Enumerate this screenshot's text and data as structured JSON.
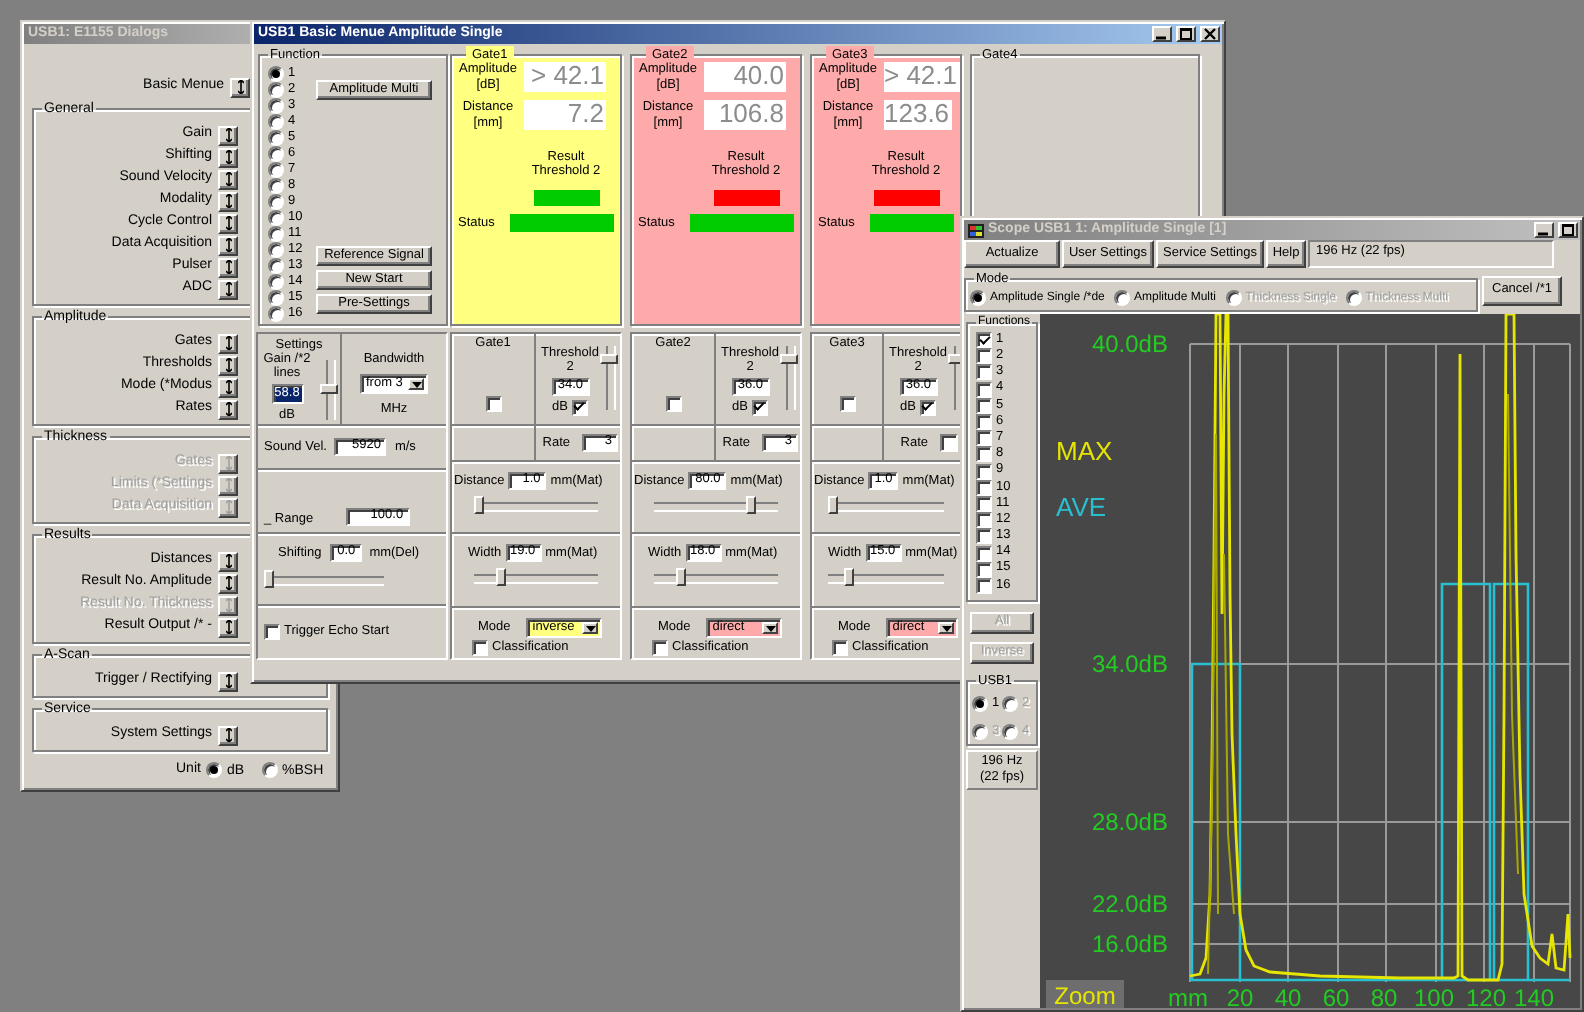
{
  "dialogs_window": {
    "title": "USB1: E1155 Dialogs",
    "active": false,
    "basic_menu": {
      "label": "Basic Menue",
      "disabled": false
    },
    "groups": [
      {
        "title": "General",
        "items": [
          {
            "label": "Gain",
            "disabled": false
          },
          {
            "label": "Shifting",
            "disabled": false
          },
          {
            "label": "Sound Velocity",
            "disabled": false
          },
          {
            "label": "Modality",
            "disabled": false
          },
          {
            "label": "Cycle Control",
            "disabled": false
          },
          {
            "label": "Data Acquisition",
            "disabled": false
          },
          {
            "label": "Pulser",
            "disabled": false
          },
          {
            "label": "ADC",
            "disabled": false
          }
        ]
      },
      {
        "title": "Amplitude",
        "items": [
          {
            "label": "Gates",
            "disabled": false
          },
          {
            "label": "Thresholds",
            "disabled": false
          },
          {
            "label": "Mode (*Modus",
            "disabled": false
          },
          {
            "label": "Rates",
            "disabled": false
          }
        ]
      },
      {
        "title": "Thickness",
        "items": [
          {
            "label": "Gates",
            "disabled": true
          },
          {
            "label": "Limits (*Settings",
            "disabled": true
          },
          {
            "label": "Data Acquisition",
            "disabled": true
          }
        ]
      },
      {
        "title": "Results",
        "items": [
          {
            "label": "Distances",
            "disabled": false
          },
          {
            "label": "Result No. Amplitude",
            "disabled": false
          },
          {
            "label": "Result No. Thickness",
            "disabled": true
          },
          {
            "label": "Result Output /* -",
            "disabled": false
          }
        ]
      },
      {
        "title": "A-Scan",
        "items": [
          {
            "label": "Trigger / Rectifying",
            "disabled": false
          }
        ]
      },
      {
        "title": "Service",
        "items": [
          {
            "label": "System Settings",
            "disabled": false
          }
        ]
      }
    ],
    "unit": {
      "label": "Unit",
      "options": [
        {
          "label": "dB",
          "selected": true
        },
        {
          "label": "%BSH",
          "selected": false
        }
      ]
    }
  },
  "basic_window": {
    "title": "USB1 Basic Menue Amplitude Single",
    "active": true,
    "function": {
      "title": "Function",
      "options": [
        {
          "label": "1",
          "selected": true
        },
        {
          "label": "2",
          "selected": false
        },
        {
          "label": "3",
          "selected": false
        },
        {
          "label": "4",
          "selected": false
        },
        {
          "label": "5",
          "selected": false
        },
        {
          "label": "6",
          "selected": false
        },
        {
          "label": "7",
          "selected": false
        },
        {
          "label": "8",
          "selected": false
        },
        {
          "label": "9",
          "selected": false
        },
        {
          "label": "10",
          "selected": false
        },
        {
          "label": "11",
          "selected": false
        },
        {
          "label": "12",
          "selected": false
        },
        {
          "label": "13",
          "selected": false
        },
        {
          "label": "14",
          "selected": false
        },
        {
          "label": "15",
          "selected": false
        },
        {
          "label": "16",
          "selected": false
        }
      ],
      "buttons": [
        "Amplitude Multi",
        "Reference Signal",
        "New Start",
        "Pre-Settings"
      ]
    },
    "settings": {
      "title": "Settings",
      "gain_label": "Gain /*2 lines",
      "gain_value": "58.8",
      "gain_unit": "dB",
      "gain_slider": {
        "level": 0.5
      },
      "bandwidth_label": "Bandwidth",
      "bandwidth_value": "from 3",
      "bandwidth_unit": "MHz"
    },
    "sound_velocity": {
      "label": "Sound Vel.",
      "value": "5920",
      "unit": "m/s"
    },
    "range": {
      "label": "_ Range",
      "value": "100.0"
    },
    "shifting": {
      "label": "Shifting",
      "value": "0.0",
      "unit": "mm(Del)",
      "level": 0
    },
    "trigger_echo_start": {
      "label": "Trigger Echo Start",
      "checked": false
    },
    "gates": [
      {
        "title": "Gate1",
        "color": "#ffff80",
        "amplitude_label": "Amplitude",
        "amplitude_unit": "[dB]",
        "amplitude": "> 42.1",
        "distance_label": "Distance",
        "distance_unit": "[mm]",
        "distance": "7.2",
        "result": {
          "label": "Result Threshold 2",
          "color": "#00cc00"
        },
        "status": {
          "label": "Status",
          "color": "#00cc00"
        },
        "settings_title": "Gate1",
        "enabled": false,
        "threshold": {
          "label": "Threshold 2",
          "value": "34.0",
          "unit": "dB",
          "checked": true,
          "level": 0.85
        },
        "rate": {
          "label": "Rate",
          "value": "3"
        },
        "distance_slider": {
          "label": "Distance",
          "value": "1.0",
          "unit": "mm(Mat)",
          "level": 0
        },
        "width_slider": {
          "label": "Width",
          "value": "19.0",
          "unit": "mm(Mat)",
          "level": 0.2
        },
        "mode": {
          "label": "Mode",
          "value": "inverse"
        },
        "classification": {
          "label": "Classification",
          "checked": false
        }
      },
      {
        "title": "Gate2",
        "color": "#ffaaaa",
        "amplitude_label": "Amplitude",
        "amplitude_unit": "[dB]",
        "amplitude": "40.0",
        "distance_label": "Distance",
        "distance_unit": "[mm]",
        "distance": "106.8",
        "result": {
          "label": "Result Threshold 2",
          "color": "#ff0000"
        },
        "status": {
          "label": "Status",
          "color": "#00cc00"
        },
        "settings_title": "Gate2",
        "enabled": false,
        "threshold": {
          "label": "Threshold 2",
          "value": "36.0",
          "unit": "dB",
          "checked": true,
          "level": 0.85
        },
        "rate": {
          "label": "Rate",
          "value": "3"
        },
        "distance_slider": {
          "label": "Distance",
          "value": "80.0",
          "unit": "mm(Mat)",
          "level": 0.8
        },
        "width_slider": {
          "label": "Width",
          "value": "18.0",
          "unit": "mm(Mat)",
          "level": 0.2
        },
        "mode": {
          "label": "Mode",
          "value": "direct"
        },
        "classification": {
          "label": "Classification",
          "checked": false
        }
      },
      {
        "title": "Gate3",
        "color": "#ffaaaa",
        "amplitude_label": "Amplitude",
        "amplitude_unit": "[dB]",
        "amplitude": "> 42.1",
        "distance_label": "Distance",
        "distance_unit": "[mm]",
        "distance": "123.6",
        "result": {
          "label": "Result Threshold 2",
          "color": "#ff0000"
        },
        "status": {
          "label": "Status",
          "color": "#00cc00"
        },
        "settings_title": "Gate3",
        "enabled": false,
        "threshold": {
          "label": "Threshold 2",
          "value": "36.0",
          "unit": "dB",
          "checked": true,
          "level": 0.85
        },
        "rate": {
          "label": "Rate"
        },
        "distance_slider": {
          "label": "Distance",
          "value": "1.0",
          "unit": "mm(Mat)",
          "level": 0
        },
        "width_slider": {
          "label": "Width",
          "value": "15.0",
          "unit": "mm(Mat)",
          "level": 0.15
        },
        "mode": {
          "label": "Mode",
          "value": "direct"
        },
        "classification": {
          "label": "Classification",
          "checked": false
        }
      }
    ],
    "gate4": {
      "title": "Gate4"
    }
  },
  "scope_window": {
    "title": "Scope USB1 1: Amplitude Single [1]",
    "active": false,
    "toolbar": [
      "Actualize",
      "User Settings",
      "Service Settings",
      "Help"
    ],
    "info": "196 Hz (22 fps)",
    "mode": {
      "title": "Mode",
      "options": [
        {
          "label": "Amplitude Single /*de",
          "selected": true,
          "disabled": false
        },
        {
          "label": "Amplitude Multi",
          "selected": false,
          "disabled": false
        },
        {
          "label": "Thickness Single",
          "selected": false,
          "disabled": true
        },
        {
          "label": "Thickness Multi",
          "selected": false,
          "disabled": true
        }
      ]
    },
    "cancel": "Cancel /*1",
    "functions": {
      "title": "Functions",
      "items": [
        {
          "label": "1",
          "checked": true
        },
        {
          "label": "2",
          "checked": false
        },
        {
          "label": "3",
          "checked": false
        },
        {
          "label": "4",
          "checked": false
        },
        {
          "label": "5",
          "checked": false
        },
        {
          "label": "6",
          "checked": false
        },
        {
          "label": "7",
          "checked": false
        },
        {
          "label": "8",
          "checked": false
        },
        {
          "label": "9",
          "checked": false
        },
        {
          "label": "10",
          "checked": false
        },
        {
          "label": "11",
          "checked": false
        },
        {
          "label": "12",
          "checked": false
        },
        {
          "label": "13",
          "checked": false
        },
        {
          "label": "14",
          "checked": false
        },
        {
          "label": "15",
          "checked": false
        },
        {
          "label": "16",
          "checked": false
        }
      ]
    },
    "list_buttons": [
      {
        "label": "All",
        "disabled": true
      },
      {
        "label": "Inverse",
        "disabled": true
      }
    ],
    "usb": {
      "title": "USB1",
      "options": [
        {
          "label": "1",
          "selected": true,
          "disabled": false
        },
        {
          "label": "2",
          "selected": false,
          "disabled": true
        },
        {
          "label": "3",
          "selected": false,
          "disabled": true
        },
        {
          "label": "4",
          "selected": false,
          "disabled": true
        }
      ]
    },
    "rate_box": "196 Hz (22 fps)",
    "plot": {
      "legend": [
        {
          "label": "MAX",
          "color": "#e6e600"
        },
        {
          "label": "AVE",
          "color": "#28c0d0"
        }
      ],
      "y_labels": [
        "40.0dB",
        "34.0dB",
        "28.0dB",
        "22.0dB",
        "16.0dB"
      ],
      "x_labels": [
        "mm",
        "20",
        "40",
        "60",
        "80",
        "100",
        "120",
        "140"
      ],
      "zoom": "Zoom"
    }
  }
}
